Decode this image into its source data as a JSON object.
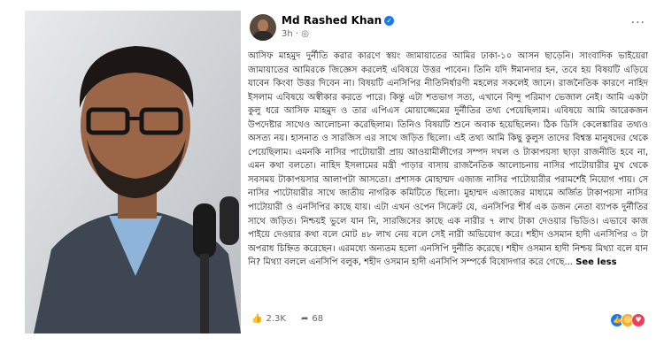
{
  "post": {
    "author": "Md Rashed Khan",
    "time": "3h",
    "privacy_dot": "·",
    "more": "···",
    "text": "আসিফ মাহমুদ দুর্নীতি করার কারণে স্বয়ং জামায়াতের আমির ঢাকা-১০ আসন ছাড়েনি। সাংবাদিক ভাইয়েরা জামায়াতের আমিরকে জিজ্ঞেস করলেই এবিষয়ে উত্তর পাবেন। তিনি যদি ঈমানদার হন, তবে হয় বিষয়টি এড়িয়ে যাবেন কিংবা উত্তর দিবেন না। বিষয়টি এনসিপির নীতিনির্ধারণী মহলের সকলেই জানে। রাজনৈতিক কারণে নাহিদ ইসলাম এবিষয়ে অস্বীকার করতে পারে। কিন্তু এটা শতভাগ সত্য, এখানে বিন্দু পরিমাণ ভেজাল নেই। আমি একটা কুলু ধরে আসিফ মাহমুদ ও তার এপিএস মোয়াজ্জেমের দুর্নীতির তথ্য পেয়েছিলাম। এবিষয়ে আমি আরেকজন উপদেষ্টার সাথেও আলোচনা করেছিলাম। তিনিও বিষয়টি শুনে অবাক হয়েছিলেন। ঠিক ডিসি কেলেঙ্কারির তথ্যও অসত্য নয়। হাসনাত ও সারজিস এর সাথে জড়িত ছিলো। এই তথ্য আমি কিছু কুলুস তাদের বিশ্বস্ত মানুষদের থেকে পেয়েছিলাম। এমনকি নাসির পাটোয়ারী প্রায় আওয়ামীলীগের সম্পদ দখল ও টাকাপয়সা ছাড়া রাজনীতি হবে না, এমন কথা বলতো। নাহিদ ইসলামের মন্ত্রী পাড়ার বাসায় রাজনৈতিক আলোচনায় নাসির পাটোয়ারীর মুখ থেকে সবসময় টাকাপয়সার আলাপটা আসতো। প্রশাসক মোহাম্মদ এজাজ নাসির পাটোয়ারীর পরামর্শেই নিয়োগ পায়। সে নাসির পাটোয়ারীর সাথে জাতীয় নাগরিক কমিটিতে ছিলো। মুহাম্মদ এজাজের মাধ্যমে অর্জিত টাকাপয়সা নাসির পাটোয়ারী ও এনসিপির কাছে যায়। এটা এখন ওপেন সিক্রেট যে, এনসিপির শীর্ষ এক ডজন নেতা ব্যাপক দুর্নীতির সাথে জড়িত। নিশ্চয়ই ভুলে যান নি, সারজিসের কাছে এক নারীর ৭ লাখ টাকা দেওয়ার ভিডিও। এভাবে কাজ পাইয়ে দেওয়ার কথা বলে মোট ৪৮ লাখ নেয় বলে সেই নারী অভিযোগ করে। শহীদ ওসমান হাদী এনসিপির ৩ টা অপরাধ চিহ্নিত করেছেন। এরমধ্যে অন্যতম হলো এনসিপি দুর্নীতি করেছে। শহীদ ওসমান হাদী নিশ্চয় মিথ্যা বলে যান নি? মিথ্যা বললে এনসিপি বলুক, শহীদ ওসমান হাদী এনসিপি সম্পর্কে বিষোদগার করে গেছে...",
    "see_less": "See less",
    "likes": "2.3K",
    "shares": "68"
  }
}
